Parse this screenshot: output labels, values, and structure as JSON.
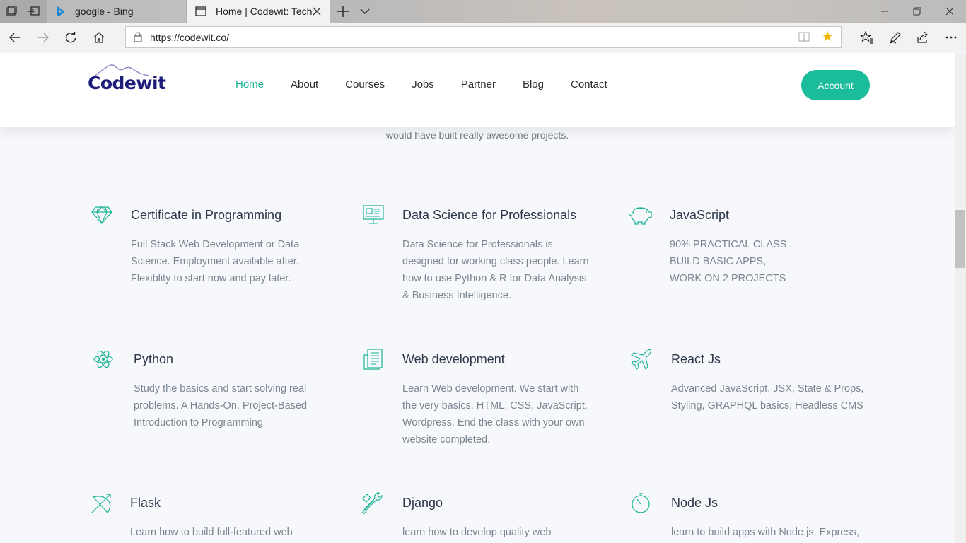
{
  "browser": {
    "tabs": [
      {
        "title": "google - Bing",
        "active": false,
        "icon": "bing-icon"
      },
      {
        "title": "Home | Codewit: Techno",
        "active": true,
        "icon": "page-icon"
      }
    ],
    "address": "https://codewit.co/"
  },
  "site": {
    "logo_text": "Codewit",
    "menu": [
      "Home",
      "About",
      "Courses",
      "Jobs",
      "Partner",
      "Blog",
      "Contact"
    ],
    "account_label": "Account",
    "partial_text": "would have built really awesome projects.",
    "features": [
      {
        "title": "Certificate in Programming",
        "icon": "diamond-icon",
        "text": [
          "Full Stack Web Development or Data",
          "Science. Employment available after.",
          "Flexiblity to start now and pay later."
        ]
      },
      {
        "title": "Data Science for Professionals",
        "icon": "presentation-icon",
        "text": [
          "Data Science for Professionals is",
          "designed for working class people. Learn",
          "how to use Python & R for Data Analysis",
          "& Business Intelligence."
        ]
      },
      {
        "title": "JavaScript",
        "icon": "piggy-bank-icon",
        "text": [
          "90% PRACTICAL CLASS",
          "BUILD BASIC APPS,",
          "WORK ON 2 PROJECTS"
        ]
      },
      {
        "title": "Python",
        "icon": "atom-icon",
        "text": [
          "Study the basics and start solving real",
          "problems. A Hands-On, Project-Based",
          "Introduction to Programming"
        ]
      },
      {
        "title": "Web development",
        "icon": "document-icon",
        "text": [
          "Learn Web development. We start with",
          "the very basics. HTML, CSS, JavaScript,",
          "Wordpress. End the class with your own",
          "website completed."
        ]
      },
      {
        "title": "React Js",
        "icon": "airplane-icon",
        "text": [
          "Advanced JavaScript, JSX, State & Props,",
          "Styling, GRAPHQL basics, Headless CMS"
        ]
      },
      {
        "title": "Flask",
        "icon": "bow-arrow-icon",
        "text": [
          "Learn how to build full-featured web"
        ]
      },
      {
        "title": "Django",
        "icon": "tools-icon",
        "text": [
          "learn how to develop quality web"
        ]
      },
      {
        "title": "Node Js",
        "icon": "stopwatch-icon",
        "text": [
          "learn to build apps with Node.js, Express,"
        ]
      }
    ]
  },
  "colors": {
    "accent": "#1abc9c",
    "logo": "#1f1d7a",
    "star": "#f2b800"
  }
}
